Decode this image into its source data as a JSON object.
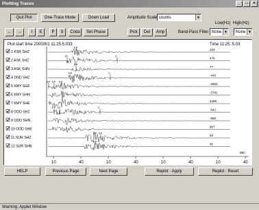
{
  "window": {
    "title": "Plotting Traces"
  },
  "toolbar": {
    "quit_plot": "Quit Plot",
    "one_trace_mode": "One-Trace Mode",
    "download": "Down Load",
    "amplitude_scale_label": "Amplitude Scale",
    "amplitude_scale_value": "counts",
    "low_hz_label": "Low(Hz)",
    "high_hz_label": "High(Hz)",
    "left_btn": "←",
    "right_btn": "→",
    "i_btn": "I",
    "e_btn": "E",
    "p_btn": "P",
    "s_btn": "S",
    "coda_btn": "Coda",
    "set_phase_btn": "Set Phase",
    "pick_btn": "Pick",
    "del_btn": "Del",
    "amp_btn": "Amp",
    "bandpass_label": "Band-Pass Filter",
    "low_value": "None",
    "high_value": "None"
  },
  "plot": {
    "start_time": "Plot start time  2000/8/1  11:25:5.033",
    "time_readout": "Time  11:25: 5.03",
    "sec_label": "sec",
    "axis_ticks": [
      "10",
      "40",
      "10",
      "40",
      "10",
      "40",
      "10",
      "40"
    ],
    "traces": [
      {
        "num": "1",
        "station": "KSR",
        "channel": "SHZ",
        "amp": "103",
        "checked": true
      },
      {
        "num": "2",
        "station": "ASK",
        "channel": "SHZ",
        "amp": "479",
        "checked": true
      },
      {
        "num": "3",
        "station": "ASK",
        "channel": "SHN",
        "amp": "77",
        "checked": true
      },
      {
        "num": "4",
        "station": "DND",
        "channel": "SHZ",
        "amp": "-449",
        "checked": true
      },
      {
        "num": "5",
        "station": "KMY",
        "channel": "SHZ",
        "amp": "-2954",
        "checked": true
      },
      {
        "num": "6",
        "station": "KMY",
        "channel": "SHN",
        "amp": "-3781",
        "checked": true
      },
      {
        "num": "7",
        "station": "KMY",
        "channel": "SHE",
        "amp": "4399",
        "checked": true
      },
      {
        "num": "8",
        "station": "ODD",
        "channel": "SHZ",
        "amp": "-542",
        "checked": true
      },
      {
        "num": "9",
        "station": "ODD",
        "channel": "SHN",
        "amp": "-558",
        "checked": true
      },
      {
        "num": "10",
        "station": "ODD",
        "channel": "SHE",
        "amp": "887",
        "checked": true
      },
      {
        "num": "11",
        "station": "SUR",
        "channel": "SHZ",
        "amp": "40",
        "checked": true
      },
      {
        "num": "12",
        "station": "SUR",
        "channel": "SHN",
        "amp": "30",
        "checked": true
      }
    ],
    "phase_labels": [
      "EP",
      "IS",
      "C",
      "EP",
      "EP",
      "C",
      "EP",
      "EP",
      "ES",
      "EP",
      "IS",
      "C",
      "EP",
      "ES",
      "EP"
    ]
  },
  "bottom_bar": {
    "help": "HELP",
    "previous_page": "Previous Page",
    "next_page": "Next Page",
    "replot_apply": "Replot · Apply",
    "replot_reset": "Replot · Reset"
  },
  "status": {
    "text": "Warning: Applet Window"
  }
}
